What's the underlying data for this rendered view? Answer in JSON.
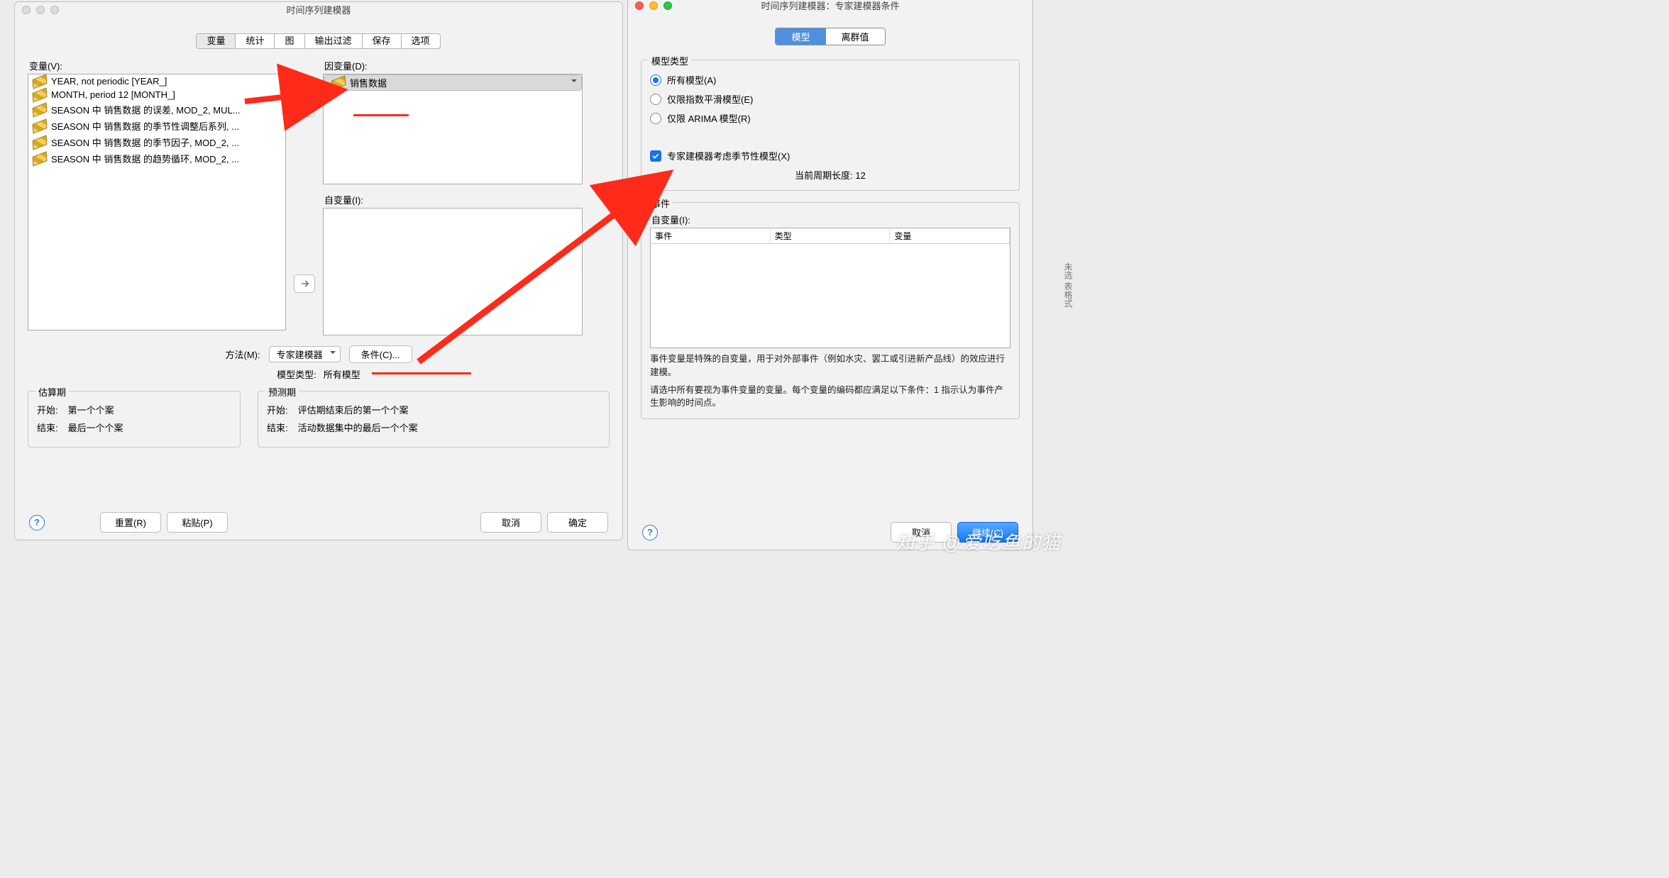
{
  "left": {
    "title": "时间序列建模器",
    "tabs": [
      "变量",
      "统计",
      "图",
      "输出过滤",
      "保存",
      "选项"
    ],
    "var_label": "变量(V):",
    "dep_label": "因变量(D):",
    "ind_label": "自变量(I):",
    "vars": [
      "YEAR, not periodic [YEAR_]",
      "MONTH, period 12 [MONTH_]",
      "SEASON 中 销售数据 的误差, MOD_2, MUL...",
      "SEASON 中 销售数据 的季节性调整后系列, ...",
      "SEASON 中 销售数据 的季节因子, MOD_2, ...",
      "SEASON 中 销售数据 的趋势循环, MOD_2, ..."
    ],
    "dep": "销售数据",
    "method_label": "方法(M):",
    "method_value": "专家建模器",
    "cond_btn": "条件(C)...",
    "model_type_label": "模型类型:",
    "model_type_value": "所有模型",
    "est": {
      "legend": "估算期",
      "start_l": "开始:",
      "start_v": "第一个个案",
      "end_l": "结束:",
      "end_v": "最后一个个案"
    },
    "fcst": {
      "legend": "预测期",
      "start_l": "开始:",
      "start_v": "评估期结束后的第一个个案",
      "end_l": "结束:",
      "end_v": "活动数据集中的最后一个个案"
    },
    "buttons": {
      "reset": "重置(R)",
      "paste": "粘贴(P)",
      "cancel": "取消",
      "ok": "确定"
    }
  },
  "right": {
    "title": "时间序列建模器：专家建模器条件",
    "tabs": [
      "模型",
      "离群值"
    ],
    "grp_model": "模型类型",
    "radios": [
      "所有模型(A)",
      "仅限指数平滑模型(E)",
      "仅限 ARIMA 模型(R)"
    ],
    "chk": "专家建模器考虑季节性模型(X)",
    "period_l": "当前周期长度:",
    "period_v": "12",
    "events_legend": "事件",
    "iv_label": "自变量(I):",
    "th": [
      "事件",
      "类型",
      "变量"
    ],
    "note1": "事件变量是特殊的自变量，用于对外部事件（例如水灾、罢工或引进新产品线）的效应进行建模。",
    "note2": "请选中所有要视为事件变量的变量。每个变量的编码都应满足以下条件：1 指示认为事件产生影响的时间点。",
    "buttons": {
      "cancel": "取消",
      "cont": "继续(C)"
    }
  },
  "wm": "知乎 @爱吃鱼的猫",
  "side": "未选\n表格式"
}
